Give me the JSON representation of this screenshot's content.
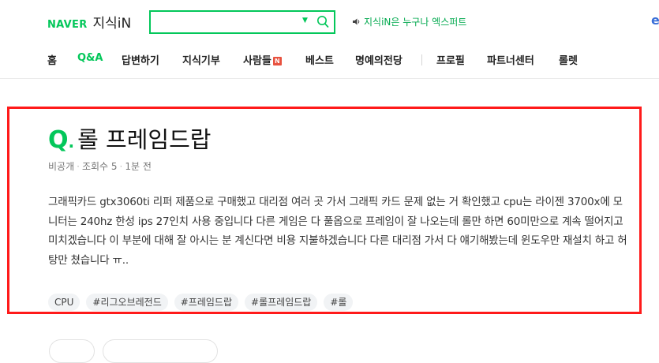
{
  "header": {
    "logo_naver": "NAVER",
    "logo_kin": "지식iN",
    "search": {
      "value": "",
      "placeholder": ""
    },
    "notice": "지식iN은 누구나 엑스퍼트"
  },
  "nav": {
    "items": [
      {
        "label": "홈"
      },
      {
        "label": "Q&A"
      },
      {
        "label": "답변하기"
      },
      {
        "label": "지식기부"
      },
      {
        "label": "사람들",
        "badge": "N"
      },
      {
        "label": "베스트"
      },
      {
        "label": "명예의전당"
      },
      {
        "label": "프로필"
      },
      {
        "label": "파트너센터"
      },
      {
        "label": "롤렛"
      }
    ]
  },
  "question": {
    "mark": "Q",
    "title": "롤 프레임드랍",
    "meta": {
      "visibility": "비공개",
      "views": "조회수 5",
      "time": "1분 전"
    },
    "body": "그래픽카드 gtx3060ti 리퍼 제품으로 구매했고 대리점 여러 곳 가서 그래픽 카드 문제 없는 거 확인했고 cpu는 라이젠 3700x에 모니터는 240hz 한성 ips 27인치 사용 중입니다 다른 게임은 다 풀옵으로 프레임이 잘 나오는데 롤만 하면 60미만으로 계속 떨어지고 미치겠습니다 이 부분에 대해 잘 아시는 분 계신다면 비용 지불하겠습니다 다른 대리점 가서 다 얘기해봤는데 윈도우만 재설치 하고 허탕만 쳤습니다 ㅠ..",
    "tags": [
      "CPU",
      "#리그오브레전드",
      "#프레임드랍",
      "#롤프레임드랍",
      "#롤"
    ]
  },
  "colors": {
    "brand": "#03c75a",
    "highlight_border": "#ff1a1a"
  }
}
